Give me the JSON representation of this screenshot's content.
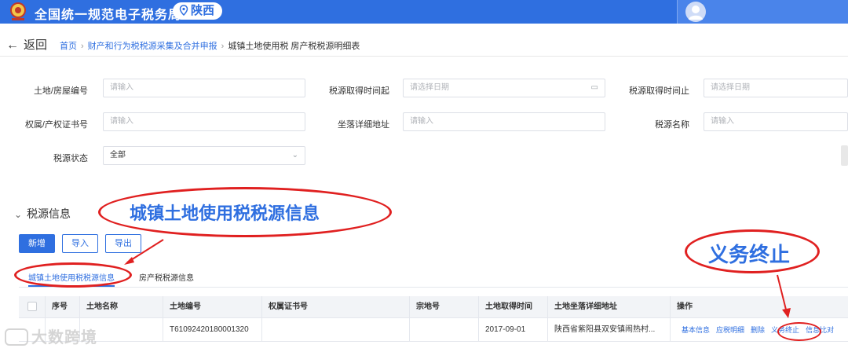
{
  "header": {
    "site_title": "全国统一规范电子税务局",
    "region": "陕西"
  },
  "nav": {
    "back_label": "返回",
    "breadcrumb": [
      "首页",
      "财产和行为税税源采集及合并申报",
      "城镇土地使用税 房产税税源明细表"
    ]
  },
  "filters": {
    "land_house_no": {
      "label": "土地/房屋编号",
      "placeholder": "请输入"
    },
    "acquire_start": {
      "label": "税源取得时间起",
      "placeholder": "请选择日期"
    },
    "acquire_end": {
      "label": "税源取得时间止",
      "placeholder": "请选择日期"
    },
    "cert_no": {
      "label": "权属/产权证书号",
      "placeholder": "请输入"
    },
    "address": {
      "label": "坐落详细地址",
      "placeholder": "请输入"
    },
    "source_name": {
      "label": "税源名称",
      "placeholder": "请输入"
    },
    "status": {
      "label": "税源状态",
      "value": "全部"
    }
  },
  "section": {
    "title": "税源信息"
  },
  "toolbar": {
    "add_label": "新增",
    "import_label": "导入",
    "export_label": "导出"
  },
  "tabs": [
    {
      "label": "城镇土地使用税税源信息",
      "active": true
    },
    {
      "label": "房产税税源信息",
      "active": false
    }
  ],
  "table": {
    "columns": [
      "序号",
      "土地名称",
      "土地编号",
      "权属证书号",
      "宗地号",
      "土地取得时间",
      "土地坐落详细地址",
      "操作"
    ],
    "rows": [
      {
        "index": "",
        "land_name": "",
        "land_no": "T61092420180001320",
        "cert_no": "",
        "parcel_no": "",
        "acquire_date": "2017-09-01",
        "address": "陕西省紫阳县双安镇闹热村...",
        "actions": [
          "基本信息",
          "应税明细",
          "删除",
          "义务终止",
          "信息比对"
        ]
      }
    ]
  },
  "annotations": {
    "land_tax_callout": "城镇土地使用税税源信息",
    "termination_callout": "义务终止",
    "annotation_color": "#e02020",
    "callout_text_color": "#2f6fe0"
  },
  "watermark": {
    "text": "大数跨境"
  },
  "colors": {
    "brand_blue": "#2f6fe0",
    "header_bg": "#2f6fe0"
  }
}
